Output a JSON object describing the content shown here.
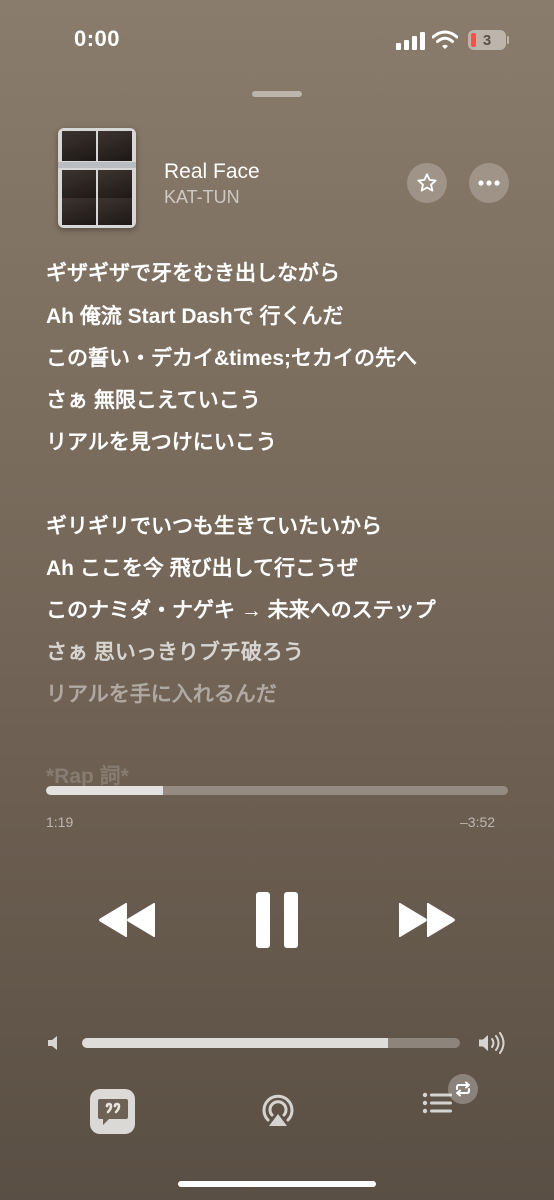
{
  "status_bar": {
    "time": "0:00",
    "battery": "3"
  },
  "now_playing": {
    "title": "Real Face",
    "artist": "KAT-TUN"
  },
  "lyrics": [
    "ギザギザで牙をむき出しながら",
    "Ah 俺流 Start Dashで 行くんだ",
    "この誓い・デカイ&times;セカイの先へ",
    "さぁ 無限こえていこう",
    "リアルを見つけにいこう",
    "ギリギリでいつも生きていたいから",
    "Ah ここを今 飛び出して行こうぜ",
    "このナミダ・ナゲキ → 未来へのステップ",
    "さぁ 思いっきりブチ破ろう",
    "リアルを手に入れるんだ",
    "*Rap 詞*"
  ],
  "progress": {
    "elapsed": "1:19",
    "remaining": "–3:52",
    "fraction": 0.253
  },
  "volume": {
    "fraction": 0.81
  },
  "icons": [
    "signal-icon",
    "wifi-icon",
    "battery-icon",
    "star-icon",
    "more-icon",
    "previous-icon",
    "pause-icon",
    "next-icon",
    "volume-low-icon",
    "volume-high-icon",
    "lyrics-icon",
    "airplay-icon",
    "queue-icon",
    "repeat-icon"
  ]
}
